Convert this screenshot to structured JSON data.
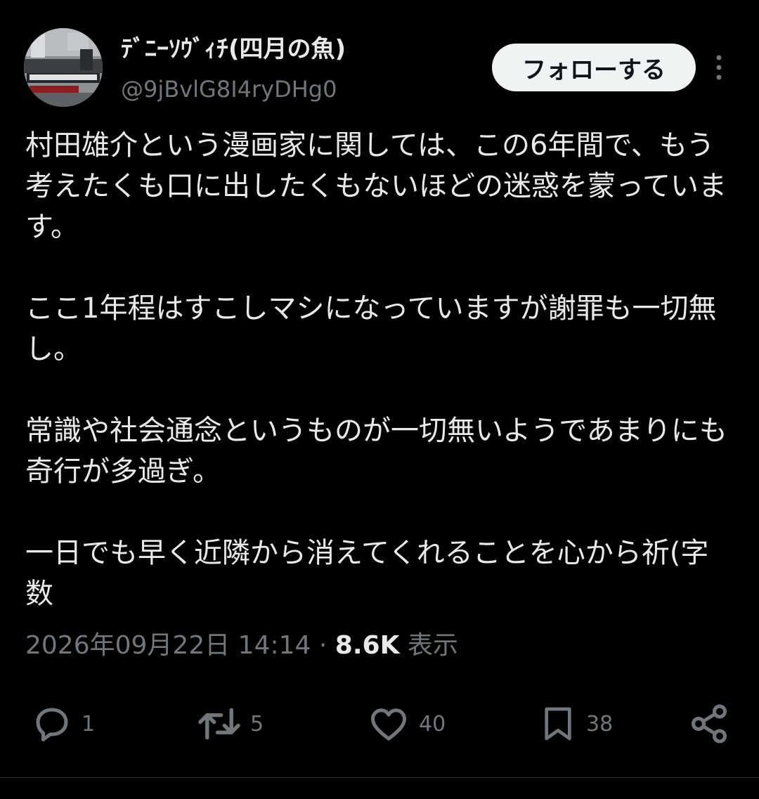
{
  "author": {
    "display_name": "ﾃﾞﾆｰｿｳﾞｨﾁ(四月の魚)",
    "handle": "@9jBvlG8I4ryDHg0"
  },
  "follow_button": {
    "label": "フォローする"
  },
  "tweet": {
    "paragraphs": [
      "村田雄介という漫画家に関しては、この6年間で、もう考えたくも口に出したくもないほどの迷惑を蒙っています。",
      "ここ1年程はすこしマシになっていますが謝罪も一切無し。",
      "常識や社会通念というものが一切無いようであまりにも奇行が多過ぎ。",
      "一日でも早く近隣から消えてくれることを心から祈(字数"
    ],
    "timestamp": "2026年09月22日 14:14",
    "separator": "·",
    "views_count": "8.6K",
    "views_label": "表示"
  },
  "actions": {
    "reply_count": "1",
    "retweet_count": "5",
    "like_count": "40",
    "bookmark_count": "38"
  },
  "icons": {
    "reply": "reply-icon",
    "retweet": "retweet-icon",
    "like": "heart-icon",
    "bookmark": "bookmark-icon",
    "share": "share-icon",
    "more": "more-vertical-icon"
  },
  "colors": {
    "background": "#000000",
    "text_primary": "#e7e9ea",
    "text_secondary": "#71767b",
    "button_bg": "#eff3f4"
  }
}
